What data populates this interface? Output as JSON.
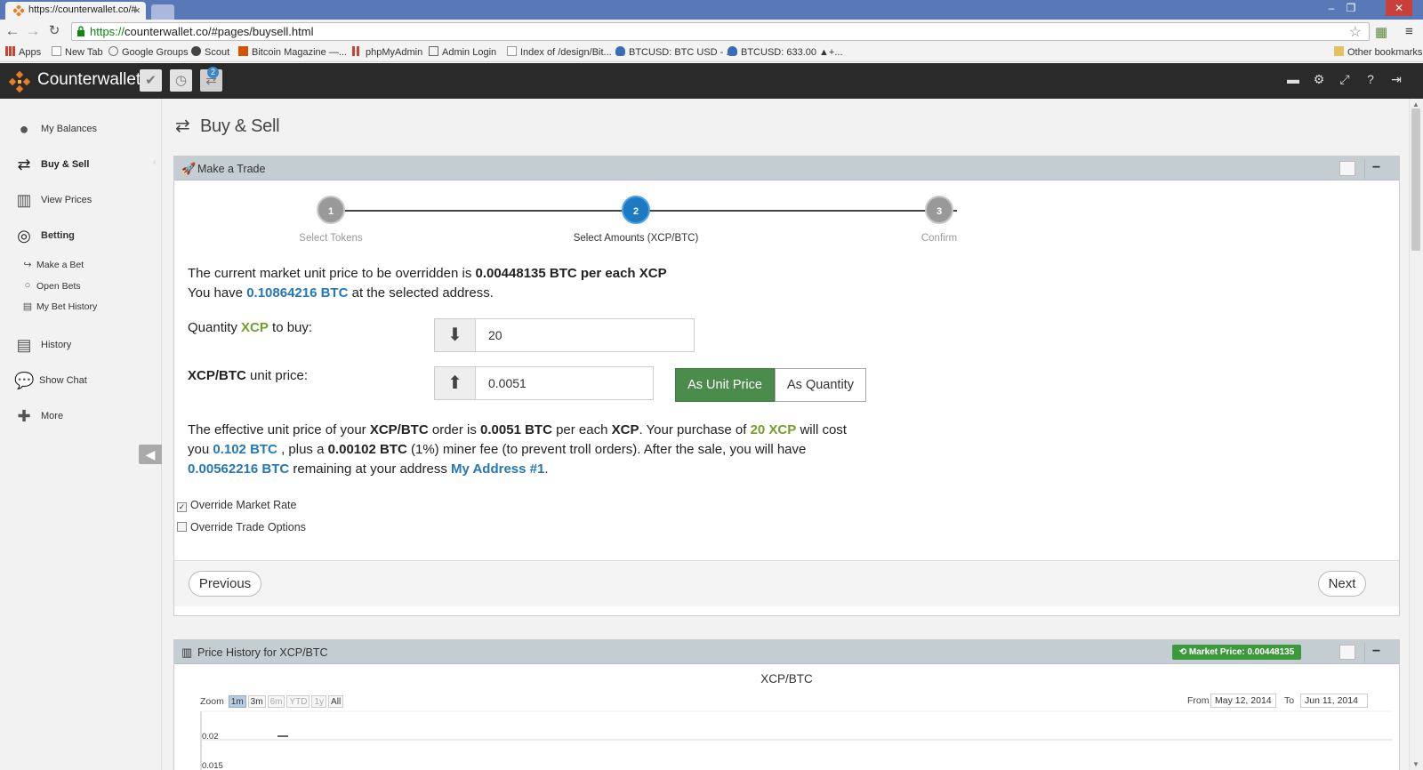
{
  "browser": {
    "tab_title": "https://counterwallet.co/#",
    "url_scheme": "https://",
    "url_rest": "counterwallet.co/#pages/buysell.html",
    "bookmarks": [
      "Apps",
      "New Tab",
      "Google Groups",
      "Scout",
      "Bitcoin Magazine —...",
      "phpMyAdmin",
      "Admin Login",
      "Index of /design/Bit...",
      "BTCUSD: BTC USD - ...",
      "BTCUSD: 633.00 ▲+..."
    ],
    "other_bookmarks": "Other bookmarks"
  },
  "header": {
    "brand": "Counterwallet",
    "badge": "2"
  },
  "sidebar": {
    "items": [
      {
        "label": "My Balances",
        "icon": "user-icon"
      },
      {
        "label": "Buy & Sell",
        "icon": "exchange-icon"
      },
      {
        "label": "View Prices",
        "icon": "bar-chart-icon"
      },
      {
        "label": "Betting",
        "icon": "target-icon"
      },
      {
        "label": "Make a Bet",
        "icon": "share-icon"
      },
      {
        "label": "Open Bets",
        "icon": "circle-icon"
      },
      {
        "label": "My Bet History",
        "icon": "book-icon"
      },
      {
        "label": "History",
        "icon": "book-icon"
      },
      {
        "label": "Show Chat",
        "icon": "chat-icon"
      },
      {
        "label": "More",
        "icon": "plus-icon"
      }
    ]
  },
  "page": {
    "title": "Buy & Sell"
  },
  "trade": {
    "title": "Make a Trade",
    "steps": [
      {
        "num": "1",
        "label": "Select Tokens"
      },
      {
        "num": "2",
        "label": "Select Amounts (XCP/BTC)"
      },
      {
        "num": "3",
        "label": "Confirm"
      }
    ],
    "line1_pre": "The current market unit price to be overridden is ",
    "line1_bold": "0.00448135 BTC per each XCP",
    "line2_pre": "You have ",
    "line2_blue": "0.10864216 BTC",
    "line2_post": " at the selected address.",
    "qty_pre": "Quantity ",
    "qty_token": "XCP",
    "qty_post": " to buy:",
    "qty_value": "20",
    "price_bold": "XCP/BTC",
    "price_post": " unit price:",
    "price_value": "0.0051",
    "as_unit_price": "As Unit Price",
    "as_quantity": "As Quantity",
    "eff": {
      "t1": "The effective unit price of your ",
      "b1": "XCP/BTC",
      "t2": " order is ",
      "b2": "0.0051 BTC",
      "t3": " per each ",
      "b3": "XCP",
      "t4": ". Your purchase of ",
      "g1": "20 XCP",
      "t5": " will cost",
      "t6": "you ",
      "bl1": "0.102 BTC",
      "t7": " , plus a ",
      "b4": "0.00102 BTC",
      "t8": " (1%) miner fee (to prevent troll orders). After the sale, you will have",
      "bl2": "0.00562216 BTC",
      "t9": " remaining at your address ",
      "bl3": "My Address #1",
      "t10": "."
    },
    "override_market": "Override Market Rate",
    "override_options": "Override Trade Options",
    "previous": "Previous",
    "next": "Next"
  },
  "history": {
    "title": "Price History for XCP/BTC",
    "market_price": "Market Price: 0.00448135",
    "chart_title": "XCP/BTC",
    "zoom_label": "Zoom",
    "zoom": [
      "1m",
      "3m",
      "6m",
      "YTD",
      "1y",
      "All"
    ],
    "from_label": "From",
    "from": "May 12, 2014",
    "to_label": "To",
    "to": "Jun 11, 2014",
    "y_ticks": [
      "0.02",
      "0.015"
    ]
  },
  "chart_data": {
    "type": "line",
    "title": "XCP/BTC",
    "series": [],
    "x": [],
    "y_ticks": [
      "0.02",
      "0.015"
    ],
    "range": {
      "from": "May 12, 2014",
      "to": "Jun 11, 2014"
    }
  }
}
